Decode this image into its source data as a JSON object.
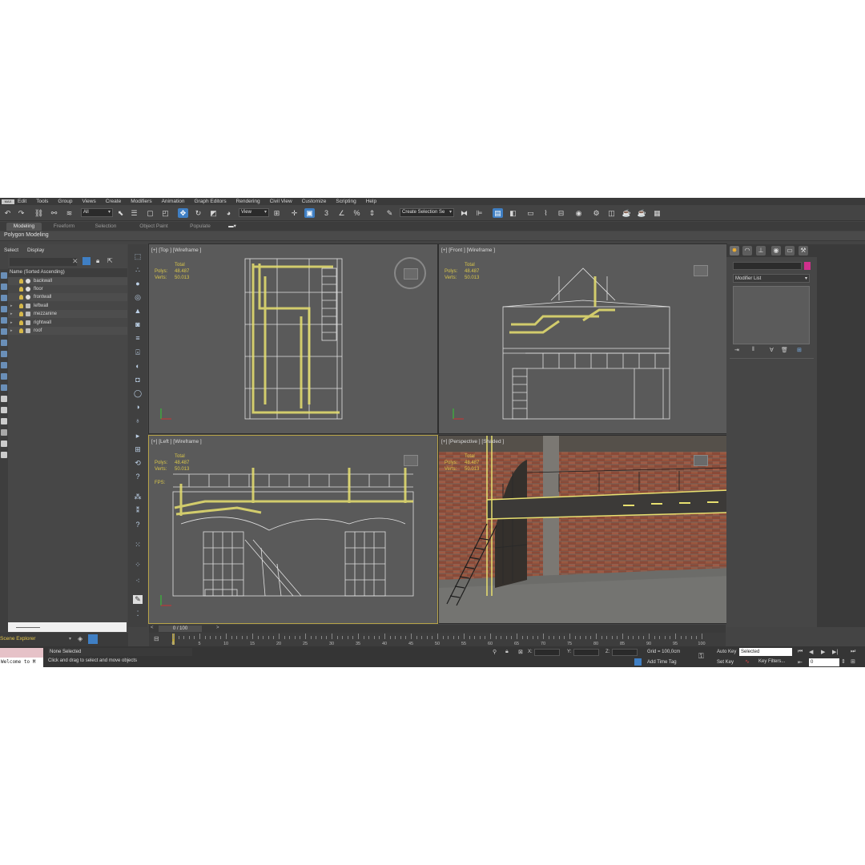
{
  "menu": [
    "Edit",
    "Tools",
    "Group",
    "Views",
    "Create",
    "Modifiers",
    "Animation",
    "Graph Editors",
    "Rendering",
    "Civil View",
    "Customize",
    "Scripting",
    "Help"
  ],
  "logo": "MAX",
  "toolbar": {
    "filter_value": "All",
    "refcoord_value": "View",
    "selection_set_placeholder": "Create Selection Se",
    "angle_snap": "3"
  },
  "ribbon": {
    "tabs": [
      "Modeling",
      "Freeform",
      "Selection",
      "Object Paint",
      "Populate"
    ],
    "active_tab": "Modeling",
    "panel_title": "Polygon Modeling"
  },
  "scene_explorer": {
    "tabs": [
      "Select",
      "Display"
    ],
    "column_header": "Name (Sorted Ascending)",
    "items": [
      {
        "name": "backwall",
        "expand": ""
      },
      {
        "name": "floor",
        "expand": ""
      },
      {
        "name": "frontwall",
        "expand": ""
      },
      {
        "name": "leftwall",
        "expand": "▸"
      },
      {
        "name": "mezzanine",
        "expand": "▸"
      },
      {
        "name": "rightwall",
        "expand": "▸"
      },
      {
        "name": "roof",
        "expand": "▸"
      }
    ],
    "footer_label": "Scene Explorer"
  },
  "viewports": {
    "top": {
      "label": "[+] [Top ] [Wireframe ]",
      "total": "Total",
      "polys_label": "Polys:",
      "polys": "48.487",
      "verts_label": "Verts:",
      "verts": "50.013"
    },
    "front": {
      "label": "[+] [Front ] [Wireframe ]",
      "total": "Total",
      "polys_label": "Polys:",
      "polys": "48.487",
      "verts_label": "Verts:",
      "verts": "50.013"
    },
    "left": {
      "label": "[+] [Left ] [Wireframe ]",
      "total": "Total",
      "polys_label": "Polys:",
      "polys": "48.487",
      "verts_label": "Verts:",
      "verts": "50.013",
      "fps_label": "FPS:"
    },
    "perspective": {
      "label": "[+] [Perspective ] [Shaded ]",
      "total": "Total",
      "polys_label": "Polys:",
      "polys": "48.487",
      "verts_label": "Verts:",
      "verts": "50.013"
    }
  },
  "command_panel": {
    "modifier_list": "Modifier List"
  },
  "timeline": {
    "slider": "0 / 100",
    "ticks": [
      "0",
      "5",
      "10",
      "15",
      "20",
      "25",
      "30",
      "35",
      "40",
      "45",
      "50",
      "55",
      "60",
      "65",
      "70",
      "75",
      "80",
      "85",
      "90",
      "95",
      "100"
    ]
  },
  "status": {
    "maxscript": "Welcome to M",
    "selection": "None Selected",
    "prompt": "Click and drag to select and move objects",
    "x_label": "X:",
    "y_label": "Y:",
    "z_label": "Z:",
    "grid": "Grid = 100,0cm",
    "add_time_tag": "Add Time Tag",
    "auto_key": "Auto Key",
    "set_key": "Set Key",
    "selected_dropdown": "Selected",
    "key_filters": "Key Filters...",
    "frame": "0"
  },
  "colors": {
    "accent_blue": "#3f7fc4",
    "stats_yellow": "#d9c64a",
    "selection_yellow": "#e8e070",
    "panel_bg": "#444444",
    "viewport_bg": "#5a5a5a"
  }
}
